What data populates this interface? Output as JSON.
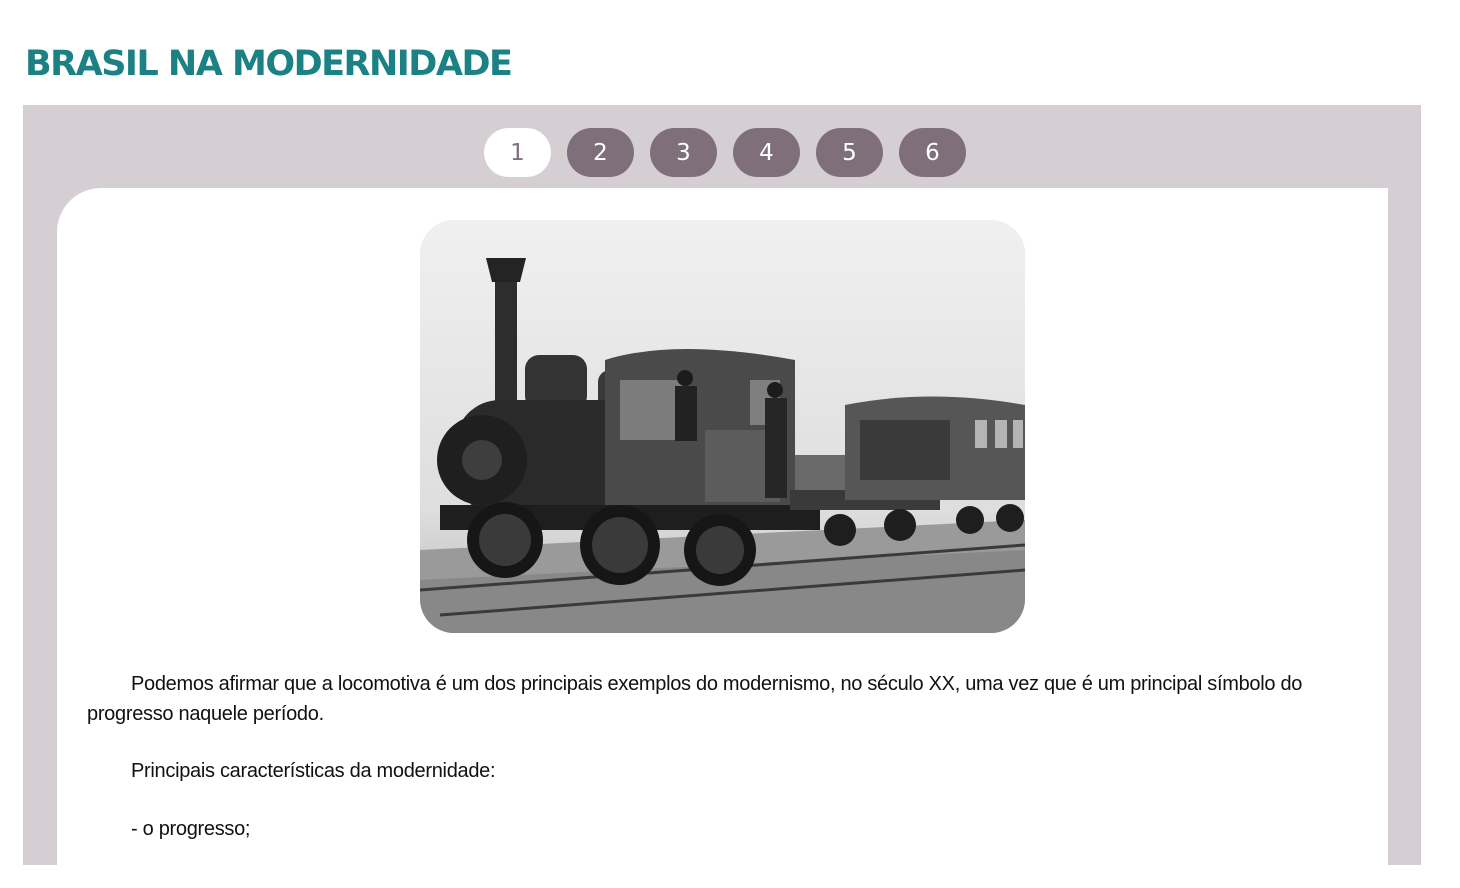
{
  "page": {
    "title": "BRASIL NA MODERNIDADE"
  },
  "pager": {
    "pages": [
      "1",
      "2",
      "3",
      "4",
      "5",
      "6"
    ],
    "active": "1"
  },
  "content": {
    "image_subject": "locomotive-photo",
    "paragraph1": "Podemos afirmar que a locomotiva é um dos principais exemplos do modernismo, no século XX, uma vez que é um principal símbolo do progresso naquele período.",
    "paragraph2": "Principais características da modernidade:",
    "paragraph3": "- o progresso;"
  },
  "colors": {
    "title": "#1b8185",
    "frame": "#d5ced3",
    "pager_button": "#7e6f7b",
    "pager_active": "#ffffff"
  }
}
